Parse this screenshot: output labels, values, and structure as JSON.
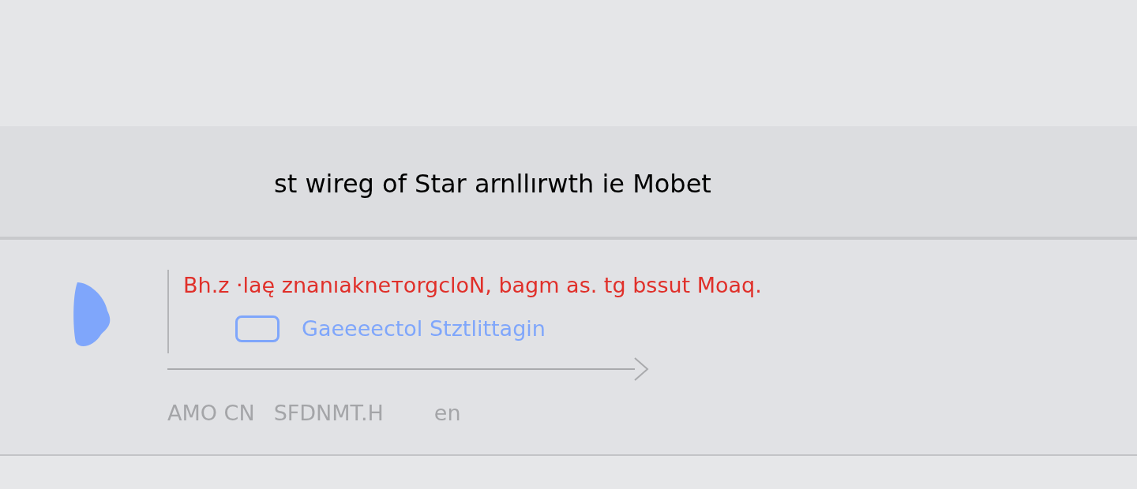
{
  "title": "st wireg of Star arnllırwth ie Mobet",
  "message": "Bh.z ·laę znanıakneтоrgcloN, bagm as. tg bssut Moaq.",
  "option": {
    "label": "Gaeeeectol Stztlittagin",
    "checked": false
  },
  "footer": [
    "AMO CN",
    "SFDNMT.H",
    "en"
  ]
}
